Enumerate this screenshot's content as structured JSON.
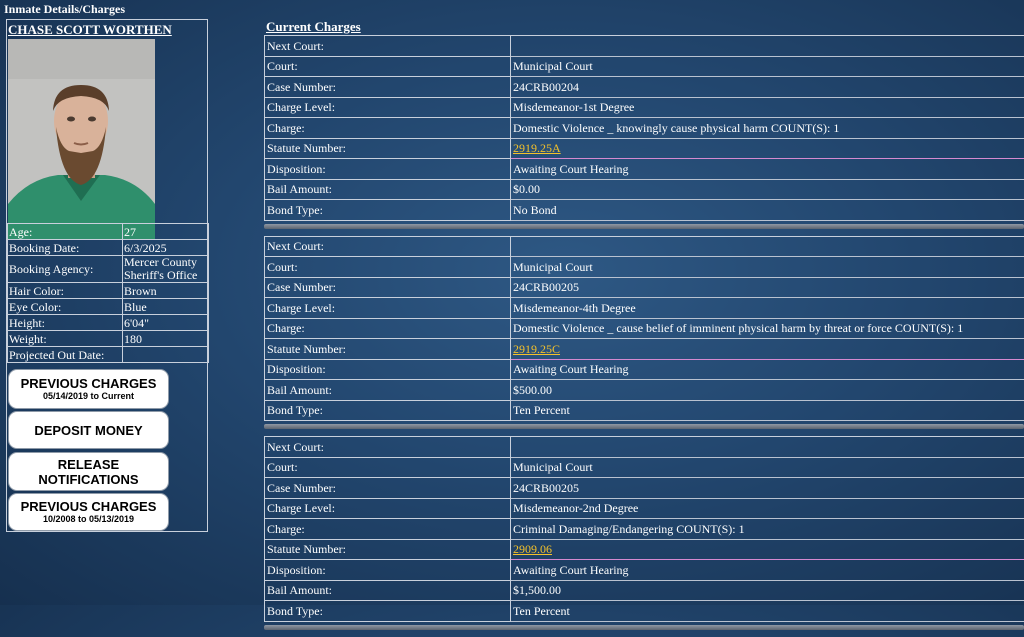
{
  "page": {
    "title": "Inmate Details/Charges",
    "current_charges_title": "Current Charges"
  },
  "inmate": {
    "name": "CHASE SCOTT WORTHEN",
    "details": [
      {
        "label": "Age:",
        "value": "27"
      },
      {
        "label": "Booking Date:",
        "value": "6/3/2025"
      },
      {
        "label": "Booking Agency:",
        "value": "Mercer County Sheriff's Office"
      },
      {
        "label": "Hair Color:",
        "value": "Brown"
      },
      {
        "label": "Eye Color:",
        "value": "Blue"
      },
      {
        "label": "Height:",
        "value": "6'04\""
      },
      {
        "label": "Weight:",
        "value": "180"
      },
      {
        "label": "Projected Out Date:",
        "value": ""
      }
    ]
  },
  "buttons": [
    {
      "main": "PREVIOUS CHARGES",
      "sub": "05/14/2019 to Current"
    },
    {
      "main": "DEPOSIT MONEY",
      "sub": ""
    },
    {
      "main": "RELEASE NOTIFICATIONS",
      "sub": ""
    },
    {
      "main": "PREVIOUS CHARGES",
      "sub": "10/2008 to 05/13/2019"
    }
  ],
  "labels": {
    "next_court": "Next Court:",
    "court": "Court:",
    "case_number": "Case Number:",
    "charge_level": "Charge Level:",
    "charge": "Charge:",
    "statute_number": "Statute Number:",
    "disposition": "Disposition:",
    "bail_amount": "Bail Amount:",
    "bond_type": "Bond Type:"
  },
  "charges": [
    {
      "next_court": "",
      "court": "Municipal Court",
      "case_number": "24CRB00204",
      "charge_level": "Misdemeanor-1st Degree",
      "charge": "Domestic Violence _ knowingly cause physical harm  COUNT(S): 1",
      "statute_number": "2919.25A",
      "disposition": "Awaiting Court Hearing",
      "bail_amount": "$0.00",
      "bond_type": "No Bond"
    },
    {
      "next_court": "",
      "court": "Municipal Court",
      "case_number": "24CRB00205",
      "charge_level": "Misdemeanor-4th Degree",
      "charge": "Domestic Violence _ cause belief of imminent physical harm by threat or force  COUNT(S): 1",
      "statute_number": "2919.25C",
      "disposition": "Awaiting Court Hearing",
      "bail_amount": "$500.00",
      "bond_type": "Ten Percent"
    },
    {
      "next_court": "",
      "court": "Municipal Court",
      "case_number": "24CRB00205",
      "charge_level": "Misdemeanor-2nd Degree",
      "charge": "Criminal Damaging/Endangering  COUNT(S): 1",
      "statute_number": "2909.06",
      "disposition": "Awaiting Court Hearing",
      "bail_amount": "$1,500.00",
      "bond_type": "Ten Percent"
    }
  ]
}
